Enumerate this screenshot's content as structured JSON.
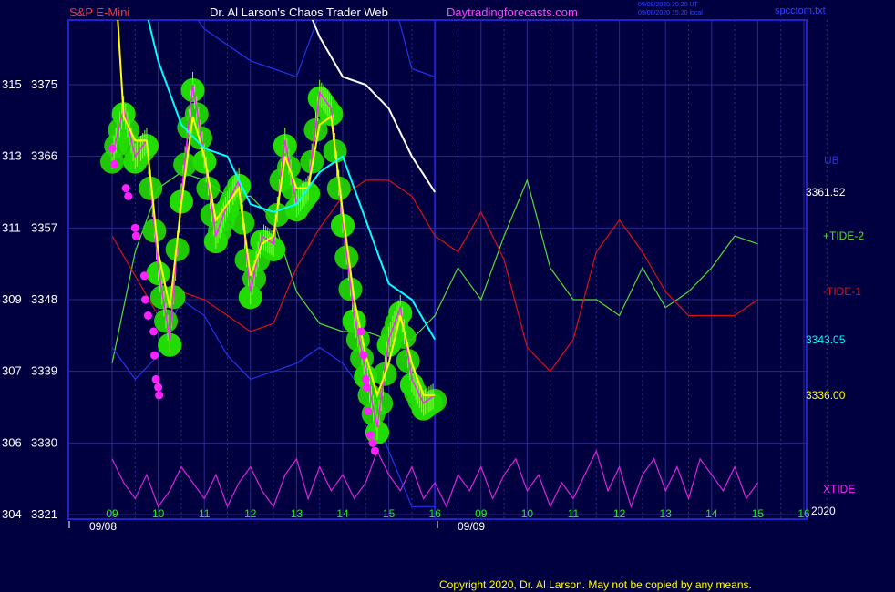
{
  "header": {
    "instrument": "S&P E-Mini",
    "title": "Dr. Al Larson's Chaos Trader Web",
    "site": "Daytradingforecasts.com",
    "stamp_utc": "09/08/2020 20:20 UT",
    "stamp_local": "09/08/2020 15:20 local",
    "file": "spcctom.txt"
  },
  "footer": {
    "copyright": "Copyright 2020, Dr. Al Larson. May not be copied by any means."
  },
  "colors": {
    "background": "#000040",
    "grid": "#2a2a8a",
    "frame": "#2222cc",
    "price_green": "#22dd00",
    "pink": "#ff22ff",
    "yellow": "#ffff00",
    "cyan": "#00ffff",
    "white": "#ffffff",
    "red": "#dd1111",
    "lightgreen": "#55dd33",
    "blue_band": "#2233ee",
    "magenta_line": "#dd22dd"
  },
  "chart_data": {
    "type": "line",
    "title": "S&P E-Mini",
    "y_axis": {
      "ticks": [
        {
          "left": "315",
          "right": "3375"
        },
        {
          "left": "313",
          "right": "3366"
        },
        {
          "left": "311",
          "right": "3357"
        },
        {
          "left": "309",
          "right": "3348"
        },
        {
          "left": "307",
          "right": "3339"
        },
        {
          "left": "306",
          "right": "3330"
        },
        {
          "left": "304",
          "right": "3321"
        }
      ],
      "range": [
        3321,
        3375
      ]
    },
    "x_axis": {
      "ticks": [
        "09",
        "10",
        "11",
        "12",
        "13",
        "14",
        "15",
        "16",
        "09",
        "10",
        "11",
        "12",
        "13",
        "14",
        "15",
        "16"
      ],
      "day_labels": [
        "09/08",
        "09/09"
      ],
      "year_label": "2020"
    },
    "right_labels": [
      {
        "text": "UB",
        "color": "#2233ee"
      },
      {
        "text": "3361.52",
        "color": "#ffffff"
      },
      {
        "text": "+TIDE-2",
        "color": "#55dd33"
      },
      {
        "text": "-TIDE-1",
        "color": "#dd1111"
      },
      {
        "text": "3343.05",
        "color": "#00ffff"
      },
      {
        "text": "3336.00",
        "color": "#ffff00"
      },
      {
        "text": "XTIDE",
        "color": "#ff22ff"
      }
    ],
    "series": [
      {
        "name": "price",
        "color": "#ff22ff",
        "x": [
          9.0,
          9.25,
          9.5,
          9.75,
          10.0,
          10.25,
          10.5,
          10.75,
          11.0,
          11.25,
          11.5,
          11.75,
          12.0,
          12.25,
          12.5,
          12.75,
          13.0,
          13.25,
          13.5,
          13.75,
          14.0,
          14.25,
          14.5,
          14.75,
          15.0,
          15.25,
          15.5,
          15.75,
          16.0
        ],
        "values": [
          3366,
          3372,
          3366,
          3368,
          3352,
          3343,
          3361,
          3375,
          3366,
          3356,
          3360,
          3363,
          3349,
          3356,
          3355,
          3368,
          3360,
          3362,
          3374,
          3372,
          3358,
          3346,
          3339,
          3332,
          3343,
          3347,
          3338,
          3335,
          3336
        ]
      },
      {
        "name": "",
        "color": "#ffff00",
        "x": [
          9.0,
          9.25,
          9.5,
          9.75,
          10.0,
          10.25,
          10.5,
          10.75,
          11.0,
          11.25,
          11.5,
          11.75,
          12.0,
          12.25,
          12.5,
          12.75,
          13.0,
          13.25,
          13.5,
          13.75,
          14.0,
          14.25,
          14.5,
          14.75,
          15.0,
          15.25,
          15.5,
          15.75,
          16.0
        ],
        "values": [
          3395,
          3371,
          3368,
          3368,
          3354,
          3347,
          3360,
          3371,
          3366,
          3358,
          3360,
          3362,
          3351,
          3355,
          3356,
          3366,
          3362,
          3362,
          3370,
          3371,
          3359,
          3348,
          3341,
          3336,
          3340,
          3346,
          3340,
          3336,
          3336
        ]
      },
      {
        "name": "",
        "color": "#00ffff",
        "x": [
          9.0,
          9.5,
          10.0,
          10.5,
          11.0,
          11.5,
          12.0,
          12.5,
          13.0,
          13.5,
          14.0,
          14.5,
          15.0,
          15.5,
          16.0
        ],
        "values": [
          3395,
          3390,
          3378,
          3370,
          3367,
          3366,
          3360,
          3359,
          3360,
          3364,
          3366,
          3358,
          3350,
          3348,
          3343
        ]
      },
      {
        "name": "",
        "color": "#ffffff",
        "x": [
          12.7,
          13.0,
          13.5,
          14.0,
          14.5,
          15.0,
          15.5,
          16.0
        ],
        "values": [
          3394,
          3388,
          3381,
          3376,
          3375,
          3372,
          3366,
          3361.5
        ]
      },
      {
        "name": "UB",
        "color": "#2233ee",
        "x": [
          9.0,
          9.5,
          10.0,
          10.5,
          11.0,
          11.5,
          12.0,
          12.5,
          13.0,
          13.5,
          14.0,
          14.5,
          15.0,
          15.5,
          16.0
        ],
        "values": [
          3395,
          3393,
          3390,
          3386,
          3382,
          3380,
          3378,
          3377,
          3376,
          3384,
          3395,
          3394,
          3388,
          3377,
          3376
        ]
      },
      {
        "name": "",
        "color": "#2233ee",
        "x": [
          9.0,
          9.5,
          10.0,
          10.5,
          11.0,
          11.5,
          12.0,
          12.5,
          13.0,
          13.5,
          14.0,
          14.5,
          15.0,
          15.5,
          16.0
        ],
        "values": [
          3342,
          3338,
          3341,
          3348,
          3346,
          3341,
          3338,
          3339,
          3340,
          3342,
          3340,
          3336,
          3329,
          3322,
          3322
        ]
      },
      {
        "name": "-TIDE-1",
        "color": "#dd1111",
        "x": [
          9.0,
          9.5,
          10.0,
          10.5,
          11.0,
          11.5,
          12.0,
          12.5,
          13.0,
          13.5,
          14.0,
          14.5,
          15.0,
          15.5,
          16.0,
          16.5,
          17.0,
          17.5,
          18.0,
          18.5,
          19.0,
          19.5,
          20.0,
          20.5,
          21.0,
          21.5,
          22.0,
          22.5,
          23.0
        ],
        "values": [
          3356,
          3351,
          3346,
          3349,
          3348,
          3346,
          3344,
          3345,
          3352,
          3357,
          3361,
          3363,
          3363,
          3361,
          3356,
          3354,
          3359,
          3353,
          3342,
          3339,
          3343,
          3354,
          3358,
          3354,
          3349,
          3346,
          3346,
          3346,
          3348
        ]
      },
      {
        "name": "+TIDE-2",
        "color": "#55dd33",
        "x": [
          9.0,
          9.5,
          10.0,
          10.5,
          11.0,
          11.5,
          12.0,
          12.5,
          13.0,
          13.5,
          14.0,
          14.5,
          15.0,
          15.5,
          16.0,
          16.5,
          17.0,
          17.5,
          18.0,
          18.5,
          19.0,
          19.5,
          20.0,
          20.5,
          21.0,
          21.5,
          22.0,
          22.5,
          23.0
        ],
        "values": [
          3340,
          3354,
          3362,
          3364,
          3363,
          3361,
          3361,
          3358,
          3349,
          3345,
          3344,
          3344,
          3343,
          3343,
          3346,
          3352,
          3348,
          3356,
          3363,
          3352,
          3348,
          3348,
          3346,
          3352,
          3347,
          3349,
          3352,
          3356,
          3355
        ]
      },
      {
        "name": "XTIDE",
        "color": "#dd22dd",
        "x": [
          9.0,
          9.25,
          9.5,
          9.75,
          10.0,
          10.25,
          10.5,
          10.75,
          11.0,
          11.25,
          11.5,
          11.75,
          12.0,
          12.25,
          12.5,
          12.75,
          13.0,
          13.25,
          13.5,
          13.75,
          14.0,
          14.25,
          14.5,
          14.75,
          15.0,
          15.25,
          15.5,
          15.75,
          16.0,
          16.25,
          16.5,
          16.75,
          17.0,
          17.25,
          17.5,
          17.75,
          18.0,
          18.25,
          18.5,
          18.75,
          19.0,
          19.25,
          19.5,
          19.75,
          20.0,
          20.25,
          20.5,
          20.75,
          21.0,
          21.25,
          21.5,
          21.75,
          22.0,
          22.25,
          22.5,
          22.75,
          23.0
        ],
        "values": [
          3328,
          3325,
          3323,
          3326,
          3322,
          3324,
          3327,
          3325,
          3323,
          3326,
          3322,
          3325,
          3327,
          3324,
          3322,
          3326,
          3328,
          3323,
          3327,
          3324,
          3326,
          3323,
          3325,
          3329,
          3326,
          3324,
          3327,
          3323,
          3325,
          3322,
          3326,
          3324,
          3327,
          3323,
          3326,
          3328,
          3324,
          3326,
          3322,
          3325,
          3323,
          3326,
          3329,
          3324,
          3327,
          3322,
          3326,
          3328,
          3324,
          3327,
          3323,
          3328,
          3326,
          3324,
          3327,
          3323,
          3325
        ]
      },
      {
        "name": "",
        "color": "#ff22ff",
        "x": [
          9.0,
          9.05,
          9.3,
          9.35,
          9.5,
          9.52,
          9.7,
          9.72,
          9.78,
          9.9,
          9.92,
          9.95,
          10.0,
          10.02,
          14.4,
          14.45,
          14.5,
          14.52,
          14.55,
          14.6,
          14.65,
          14.7
        ],
        "values": [
          3367,
          3365,
          3362,
          3361,
          3357,
          3356,
          3351,
          3348,
          3346,
          3344,
          3341,
          3338,
          3337,
          3336,
          3344,
          3341,
          3338,
          3337,
          3334,
          3331,
          3330,
          3329
        ]
      }
    ]
  }
}
